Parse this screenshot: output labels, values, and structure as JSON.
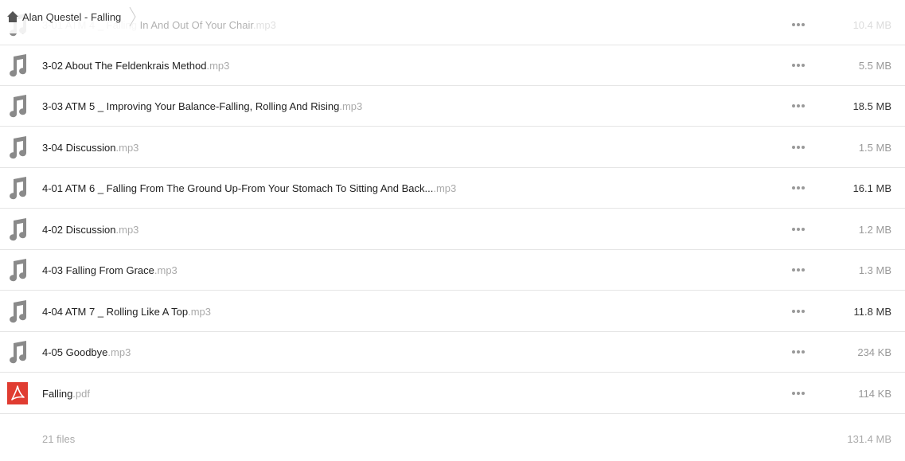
{
  "breadcrumb": {
    "home_icon": "home-icon",
    "folder": "Alan Questel - Falling"
  },
  "files": [
    {
      "name": "3-01 ATM 4 _ Falling In And Out Of Your Chair",
      "ext": ".mp3",
      "size": "10.4 MB",
      "icon": "music-note-icon"
    },
    {
      "name": "3-02 About The Feldenkrais Method",
      "ext": ".mp3",
      "size": "5.5 MB",
      "icon": "music-note-icon"
    },
    {
      "name": "3-03 ATM 5 _ Improving Your Balance-Falling, Rolling And Rising",
      "ext": ".mp3",
      "size": "18.5 MB",
      "icon": "music-note-icon"
    },
    {
      "name": "3-04 Discussion",
      "ext": ".mp3",
      "size": "1.5 MB",
      "icon": "music-note-icon"
    },
    {
      "name": "4-01 ATM 6 _ Falling From The Ground Up-From Your Stomach To Sitting And Back...",
      "ext": ".mp3",
      "size": "16.1 MB",
      "icon": "music-note-icon"
    },
    {
      "name": "4-02 Discussion",
      "ext": ".mp3",
      "size": "1.2 MB",
      "icon": "music-note-icon"
    },
    {
      "name": "4-03 Falling From Grace",
      "ext": ".mp3",
      "size": "1.3 MB",
      "icon": "music-note-icon"
    },
    {
      "name": "4-04 ATM 7 _ Rolling Like A Top",
      "ext": ".mp3",
      "size": "11.8 MB",
      "icon": "music-note-icon"
    },
    {
      "name": "4-05 Goodbye",
      "ext": ".mp3",
      "size": "234 KB",
      "icon": "music-note-icon"
    },
    {
      "name": "Falling",
      "ext": ".pdf",
      "size": "114 KB",
      "icon": "pdf-icon"
    }
  ],
  "footer": {
    "count": "21 files",
    "total": "131.4 MB"
  },
  "colors": {
    "pdf_red": "#e03c31",
    "icon_gray": "#8a8a8a"
  }
}
